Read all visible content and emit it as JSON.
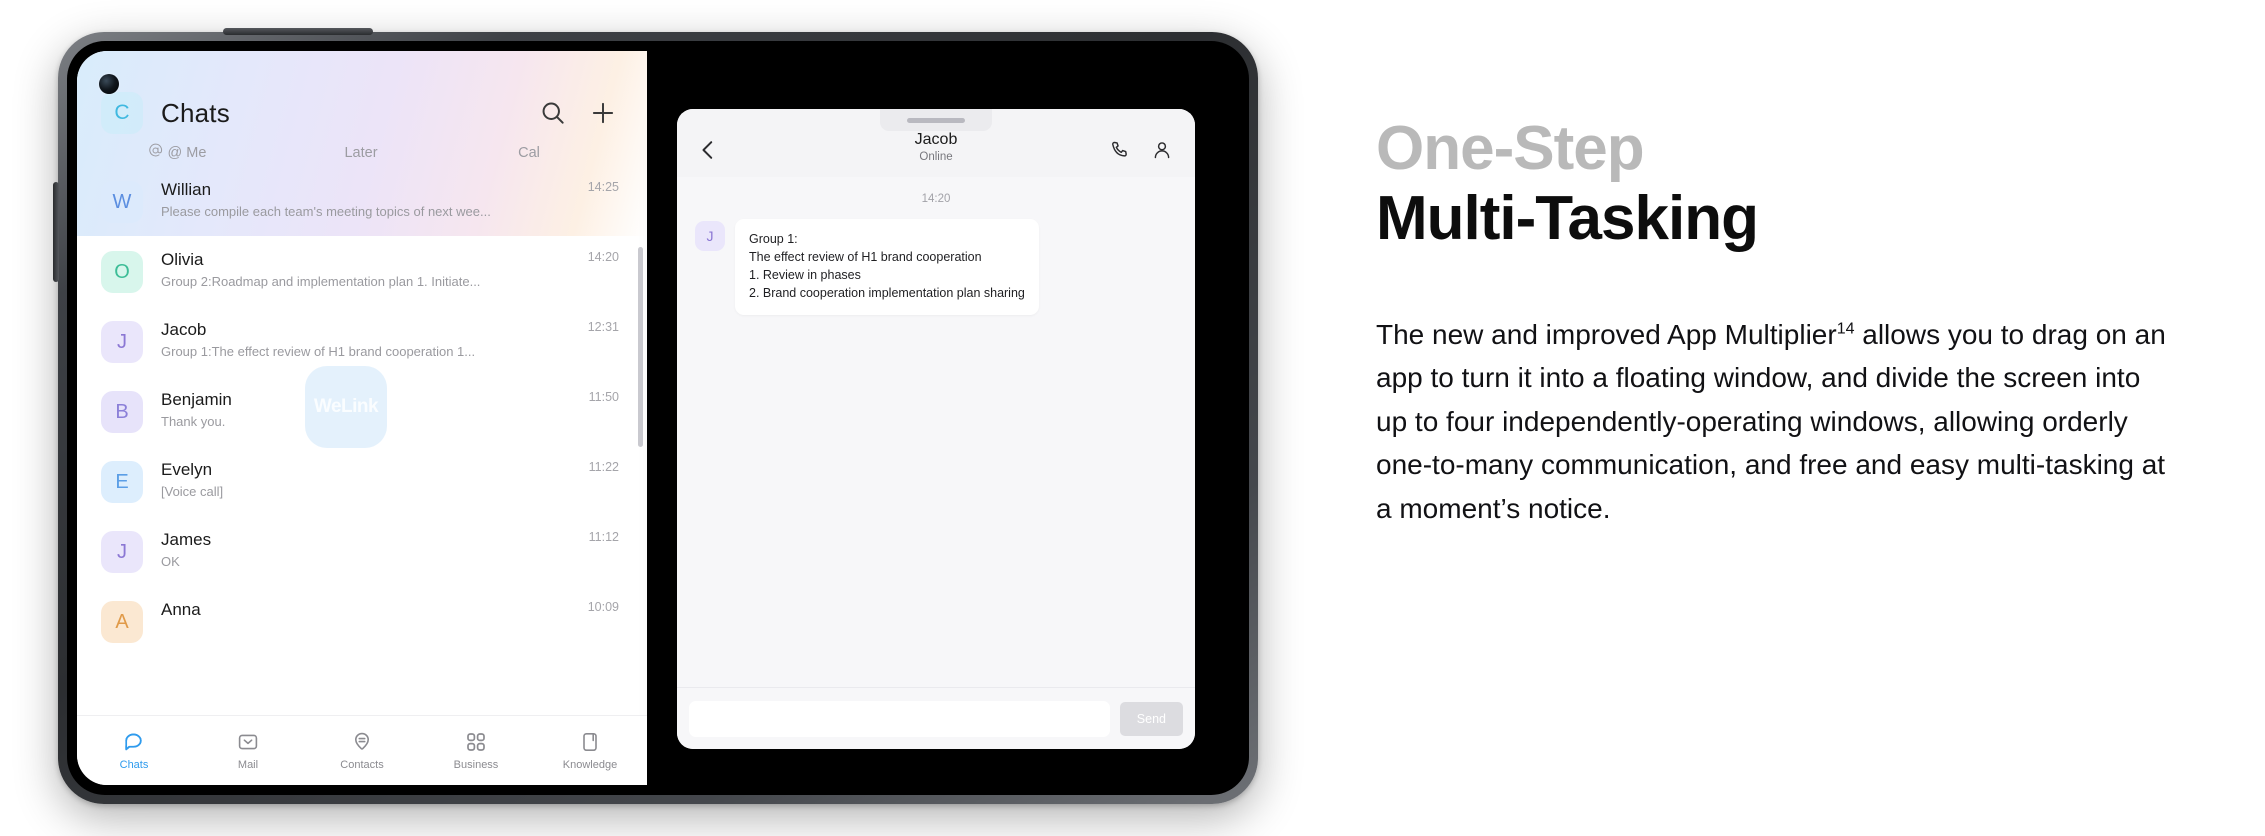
{
  "device": {
    "name": "tablet-device"
  },
  "chat_list_app": {
    "account_initial": "C",
    "title": "Chats",
    "header_icons": [
      "search-icon",
      "plus-icon"
    ],
    "filter_tabs": [
      {
        "label": "@ Me",
        "icon": "at-icon"
      },
      {
        "label": "Later"
      },
      {
        "label": "Cal"
      }
    ],
    "watermark": "WeLink",
    "conversations": [
      {
        "initial": "W",
        "name": "Willian",
        "preview": "Please compile each team's meeting topics of next wee...",
        "time": "14:25",
        "av_bg": "#dceafc",
        "av_fg": "#5b8ee0"
      },
      {
        "initial": "O",
        "name": "Olivia",
        "preview": "Group 2:Roadmap and implementation plan  1. Initiate...",
        "time": "14:20",
        "av_bg": "#d8f6ec",
        "av_fg": "#3dbd97"
      },
      {
        "initial": "J",
        "name": "Jacob",
        "preview": "Group 1:The effect review of H1 brand cooperation  1...",
        "time": "12:31",
        "av_bg": "#eae6fb",
        "av_fg": "#8b77d4"
      },
      {
        "initial": "B",
        "name": "Benjamin",
        "preview": "Thank you.",
        "time": "11:50",
        "av_bg": "#e7e3fa",
        "av_fg": "#8b7fd8"
      },
      {
        "initial": "E",
        "name": "Evelyn",
        "preview": "[Voice call]",
        "time": "11:22",
        "av_bg": "#ddeefd",
        "av_fg": "#5b9ee6"
      },
      {
        "initial": "J",
        "name": "James",
        "preview": "OK",
        "time": "11:12",
        "av_bg": "#eae6fb",
        "av_fg": "#8b77d4"
      },
      {
        "initial": "A",
        "name": "Anna",
        "preview": "",
        "time": "10:09",
        "av_bg": "#fbe8d2",
        "av_fg": "#e09a49"
      }
    ],
    "bottom_nav": {
      "active_color": "#2f9bed",
      "items": [
        {
          "label": "Chats",
          "icon": "chat-bubble-icon",
          "active": true
        },
        {
          "label": "Mail",
          "icon": "mail-icon",
          "active": false
        },
        {
          "label": "Contacts",
          "icon": "contacts-icon",
          "active": false
        },
        {
          "label": "Business",
          "icon": "grid-apps-icon",
          "active": false
        },
        {
          "label": "Knowledge",
          "icon": "book-icon",
          "active": false
        }
      ]
    }
  },
  "floating_window": {
    "back_icon": "chevron-left-icon",
    "contact_name": "Jacob",
    "presence": "Online",
    "header_icons": [
      "phone-icon",
      "contact-person-icon"
    ],
    "message_timestamp": "14:20",
    "message": {
      "avatar_initial": "J",
      "lines": [
        "Group 1:",
        "The effect review of H1 brand cooperation",
        "1. Review in phases",
        "2. Brand cooperation implementation plan sharing"
      ]
    },
    "compose": {
      "value": "",
      "placeholder": "",
      "send_label": "Send"
    }
  },
  "marketing": {
    "heading_line1": "One-Step",
    "heading_line2": "Multi-Tasking",
    "heading_line1_color": "#b9b9b9",
    "heading_line2_color": "#0d0d0d",
    "body_before": "The new and improved App Multiplier",
    "body_superscript": "14",
    "body_after": " allows you to drag on an app to turn it into a floating window, and divide the screen into up to four independently-operating windows, allowing orderly one-to-many communication, and free and easy multi-tasking at a moment’s notice."
  }
}
